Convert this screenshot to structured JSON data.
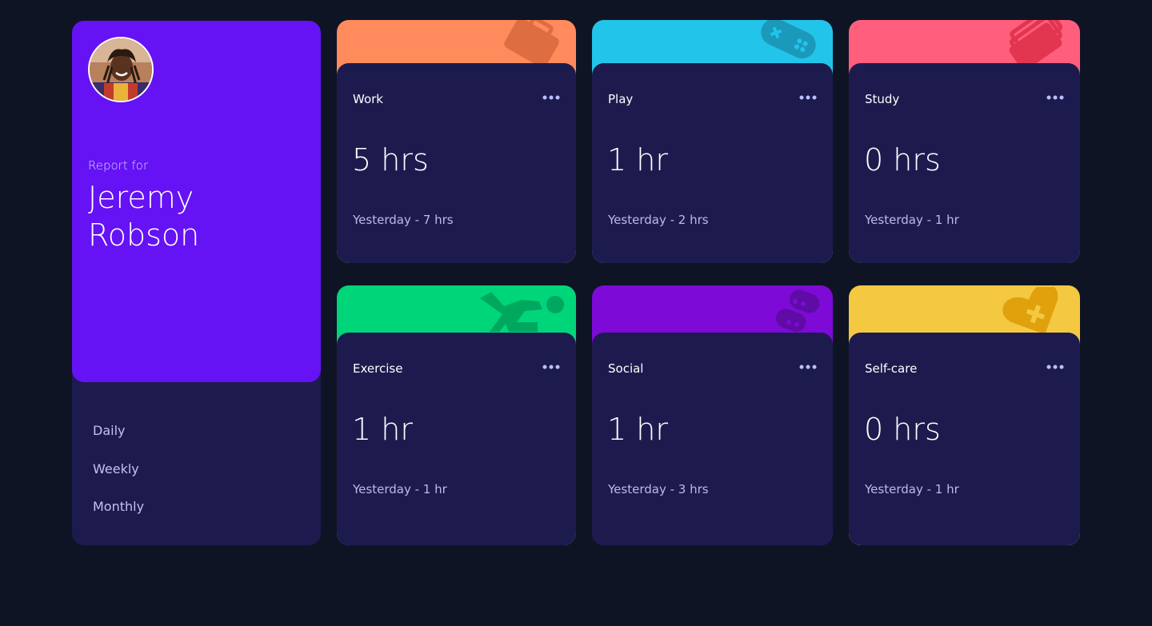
{
  "colors": {
    "background": "#0f1424",
    "card": "#1d1b4e",
    "profile": "#6512f5",
    "work": "#ff8b5d",
    "play": "#23c4ea",
    "study": "#ff5e7c",
    "exercise": "#00d579",
    "social": "#7d0ad6",
    "selfcare": "#f5c842"
  },
  "profile": {
    "report_label": "Report for",
    "name": "Jeremy Robson",
    "avatar_icon": "avatar-photo"
  },
  "timeframes": [
    {
      "label": "Daily"
    },
    {
      "label": "Weekly"
    },
    {
      "label": "Monthly"
    }
  ],
  "activities": [
    {
      "title": "Work",
      "current": "5 hrs",
      "previous": "Yesterday - 7 hrs",
      "icon": "briefcase-icon"
    },
    {
      "title": "Play",
      "current": "1 hr",
      "previous": "Yesterday - 2 hrs",
      "icon": "gamepad-icon"
    },
    {
      "title": "Study",
      "current": "0 hrs",
      "previous": "Yesterday - 1 hr",
      "icon": "books-icon"
    },
    {
      "title": "Exercise",
      "current": "1 hr",
      "previous": "Yesterday - 1 hr",
      "icon": "runner-icon"
    },
    {
      "title": "Social",
      "current": "1 hr",
      "previous": "Yesterday - 3 hrs",
      "icon": "chat-icon"
    },
    {
      "title": "Self-care",
      "current": "0 hrs",
      "previous": "Yesterday - 1 hr",
      "icon": "heart-icon"
    }
  ]
}
